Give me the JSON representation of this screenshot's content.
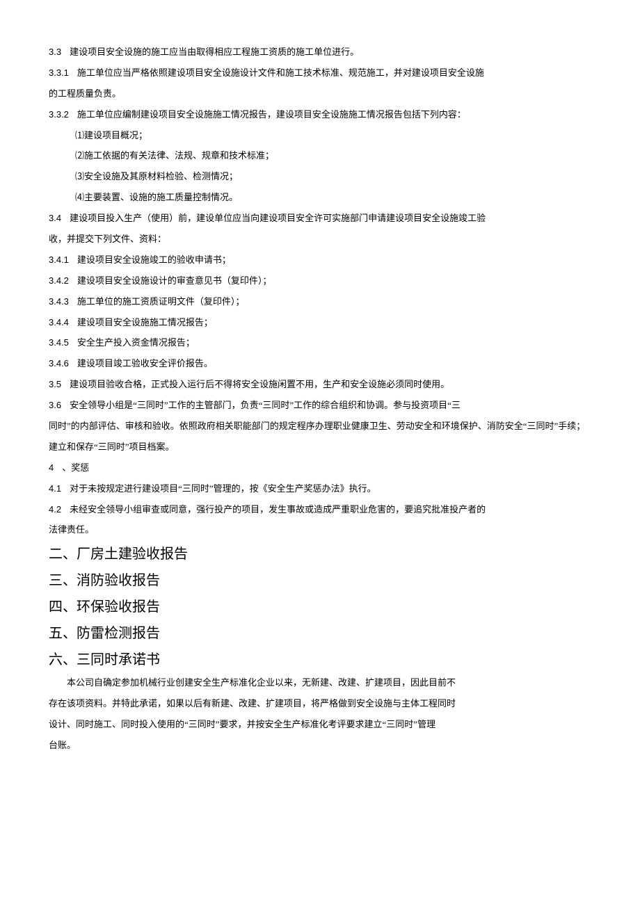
{
  "p": [
    {
      "n": "3.3",
      "t": "建设项目安全设施的施工应当由取得相应工程施工资质的施工单位进行。"
    },
    {
      "n": "3.3.1",
      "t": "施工单位应当严格依照建设项目安全设施设计文件和施工技术标准、规范施工，并对建设项目安全设施"
    },
    {
      "n": "",
      "t": "的工程质量负责。"
    },
    {
      "n": "3.3.2",
      "t": "施工单位应编制建设项目安全设施施工情况报告，建设项目安全设施施工情况报告包括下列内容："
    },
    {
      "n": "",
      "t": "⑴建设项目概况；",
      "cls": "indent1"
    },
    {
      "n": "",
      "t": "⑵施工依据的有关法律、法规、规章和技术标准；",
      "cls": "indent1"
    },
    {
      "n": "",
      "t": "⑶安全设施及其原材料检验、检测情况；",
      "cls": "indent1"
    },
    {
      "n": "",
      "t": "⑷主要装置、设施的施工质量控制情况。",
      "cls": "indent1"
    },
    {
      "n": "3.4",
      "t": "建设项目投入生产（使用）前，建设单位应当向建设项目安全许可实施部门申请建设项目安全设施竣工验"
    },
    {
      "n": "",
      "t": "收，并提交下列文件、资料："
    },
    {
      "n": "3.4.1",
      "t": "建设项目安全设施竣工的验收申请书；"
    },
    {
      "n": "3.4.2",
      "t": "建设项目安全设施设计的审查意见书（复印件）；"
    },
    {
      "n": "3.4.3",
      "t": "施工单位的施工资质证明文件（复印件）；"
    },
    {
      "n": "3.4.4",
      "t": "建设项目安全设施施工情况报告；"
    },
    {
      "n": "3.4.5",
      "t": "安全生产投入资金情况报告；"
    },
    {
      "n": "3.4.6",
      "t": "建设项目竣工验收安全评价报告。"
    },
    {
      "n": "3.5",
      "t": "建设项目验收合格，正式投入运行后不得将安全设施闲置不用，生产和安全设施必须同时使用。"
    },
    {
      "n": "3.6",
      "t": "安全领导小组是“三同时”工作的主管部门，负责“三同时”工作的综合组织和协调。参与投资项目“三"
    },
    {
      "n": "",
      "t": "同时”的内部评估、审核和验收。依照政府相关职能部门的规定程序办理职业健康卫生、劳动安全和环境保护、消防安全“三同时”手续；建立和保存“三同时”项目档案。"
    },
    {
      "n": "4",
      "t": "、奖惩"
    },
    {
      "n": "4.1",
      "t": "对于未按规定进行建设项目“三同时”管理的，按《安全生产奖惩办法》执行。"
    },
    {
      "n": "4.2",
      "t": "未经安全领导小组审查或同意，强行投产的项目，发生事故或造成严重职业危害的，要追究批准投产者的"
    },
    {
      "n": "",
      "t": "法律责任。"
    }
  ],
  "headings": [
    "二、厂房土建验收报告",
    "三、消防验收报告",
    "四、环保验收报告",
    "五、防雷检测报告",
    "六、三同时承诺书"
  ],
  "commit": [
    "本公司自确定参加机械行业创建安全生产标准化企业以来，无新建、改建、扩建项目，因此目前不",
    "存在该项资料。并特此承诺，如果以后有新建、改建、扩建项目，将严格做到安全设施与主体工程同时",
    "设计、同时施工、同时投入使用的“三同时”要求，并按安全生产标准化考评要求建立“三同时”管理",
    "台账。"
  ]
}
